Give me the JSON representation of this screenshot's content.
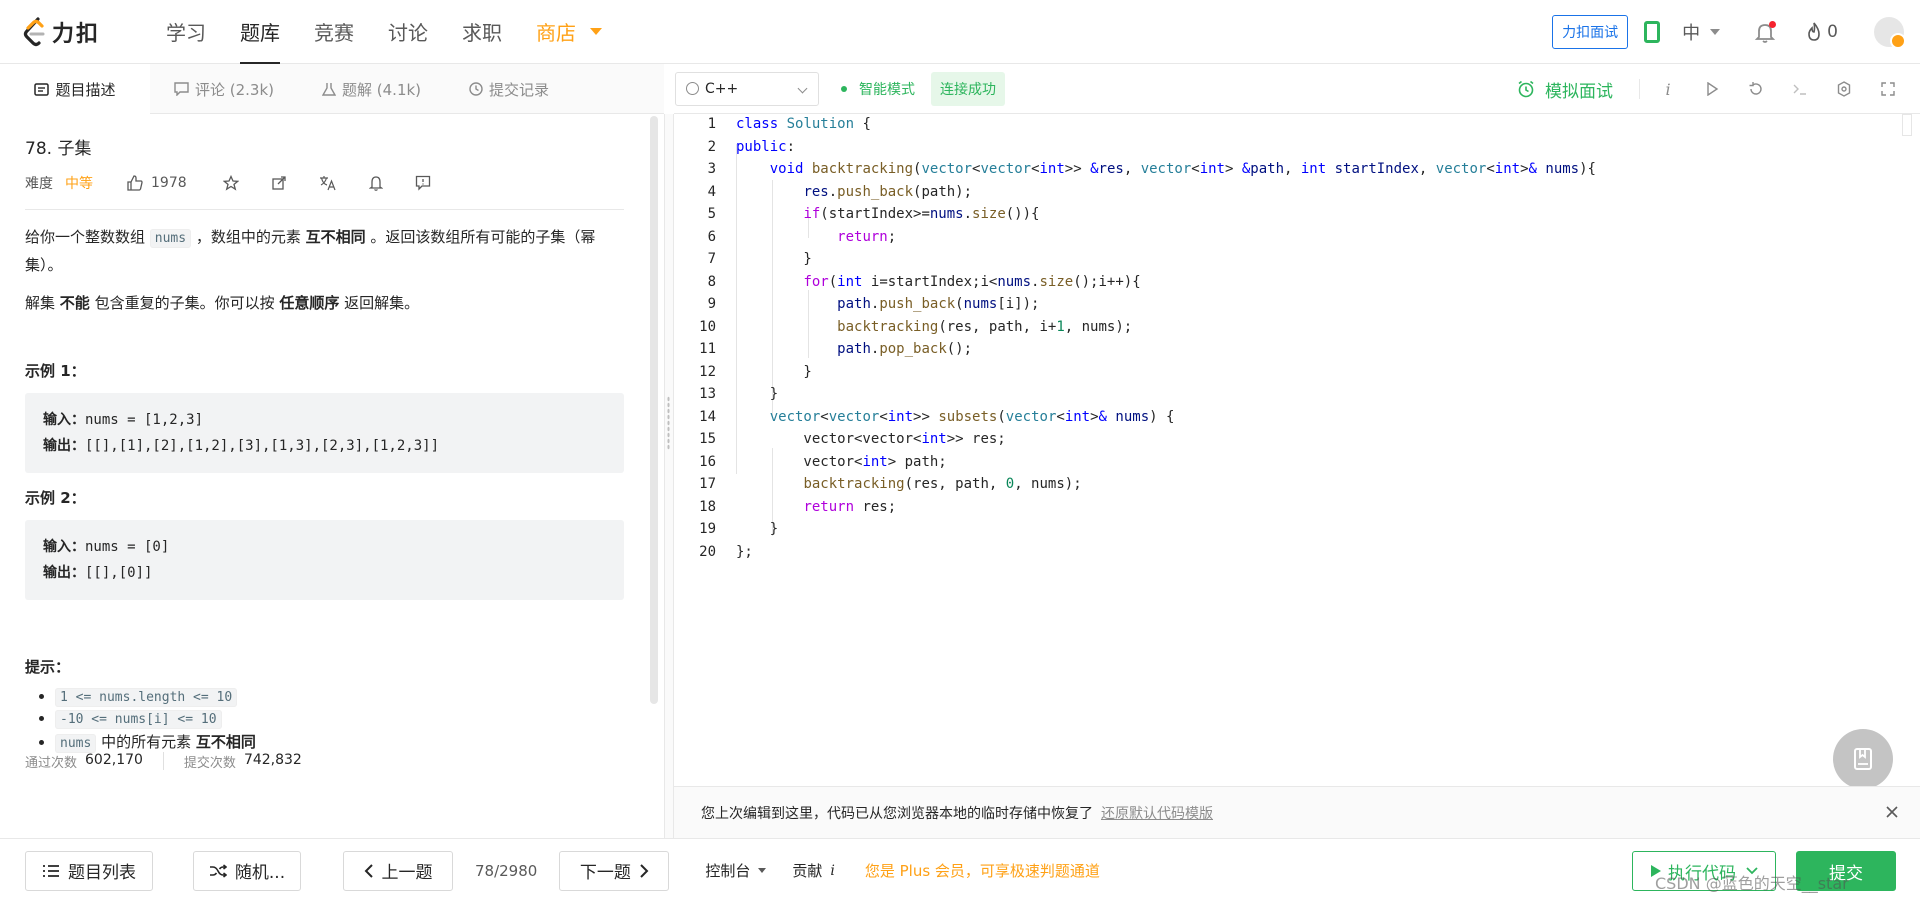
{
  "nav": {
    "logo_text": "力扣",
    "items": [
      {
        "label": "学习",
        "active": false
      },
      {
        "label": "题库",
        "active": true
      },
      {
        "label": "竞赛",
        "active": false
      },
      {
        "label": "讨论",
        "active": false
      },
      {
        "label": "求职",
        "active": false
      }
    ],
    "store_label": "商店",
    "interview_button": "力扣面试",
    "lang_switch": "中",
    "flame_count": "0"
  },
  "left_tabs": [
    {
      "label": "题目描述",
      "icon": "description-icon",
      "active": true
    },
    {
      "label": "评论 (2.3k)",
      "icon": "comment-icon",
      "active": false
    },
    {
      "label": "题解 (4.1k)",
      "icon": "flask-icon",
      "active": false
    },
    {
      "label": "提交记录",
      "icon": "history-icon",
      "active": false
    }
  ],
  "problem": {
    "title": "78. 子集",
    "difficulty_label": "难度",
    "difficulty": "中等",
    "likes": "1978",
    "desc1_pre": "给你一个整数数组 ",
    "desc1_code": "nums",
    "desc1_mid": " ，数组中的元素 ",
    "desc1_bold": "互不相同",
    "desc1_post": " 。返回该数组所有可能的子集（幂集）。",
    "desc2_pre": "解集 ",
    "desc2_bold1": "不能",
    "desc2_mid": " 包含重复的子集。你可以按 ",
    "desc2_bold2": "任意顺序",
    "desc2_post": " 返回解集。",
    "example1_title": "示例 1：",
    "example1_input_label": "输入：",
    "example1_input": "nums = [1,2,3]",
    "example1_output_label": "输出：",
    "example1_output": "[[],[1],[2],[1,2],[3],[1,3],[2,3],[1,2,3]]",
    "example2_title": "示例 2：",
    "example2_input_label": "输入：",
    "example2_input": "nums = [0]",
    "example2_output_label": "输出：",
    "example2_output": "[[],[0]]",
    "hints_title": "提示：",
    "hint1": "1 <= nums.length <= 10",
    "hint2": "-10 <= nums[i] <= 10",
    "hint3_code": "nums",
    "hint3_text": " 中的所有元素 ",
    "hint3_bold": "互不相同"
  },
  "stats": {
    "accepted_label": "通过次数",
    "accepted": "602,170",
    "submitted_label": "提交次数",
    "submitted": "742,832"
  },
  "editor": {
    "language": "C++",
    "smart_mode": "智能模式",
    "connection": "连接成功",
    "mock_interview": "模拟面试",
    "line_numbers": [
      "1",
      "2",
      "3",
      "4",
      "5",
      "6",
      "7",
      "8",
      "9",
      "10",
      "11",
      "12",
      "13",
      "14",
      "15",
      "16",
      "17",
      "18",
      "19",
      "20"
    ]
  },
  "notice": {
    "text": "您上次编辑到这里，代码已从您浏览器本地的临时存储中恢复了",
    "link": "还原默认代码模版"
  },
  "bottom": {
    "list_button": "题目列表",
    "random_button": "随机...",
    "prev_button": "上一题",
    "pager": "78/2980",
    "next_button": "下一题",
    "console": "控制台",
    "contribute": "贡献",
    "contribute_icon": "i",
    "plus_text": "您是 Plus 会员，可享极速判题通道",
    "run_button": "执行代码",
    "submit_button": "提交"
  },
  "watermark": "CSDN @蓝色的天空__star",
  "colors": {
    "accent_green": "#2db55d",
    "accent_orange": "#ffa116",
    "link_blue": "#1a73e8"
  }
}
